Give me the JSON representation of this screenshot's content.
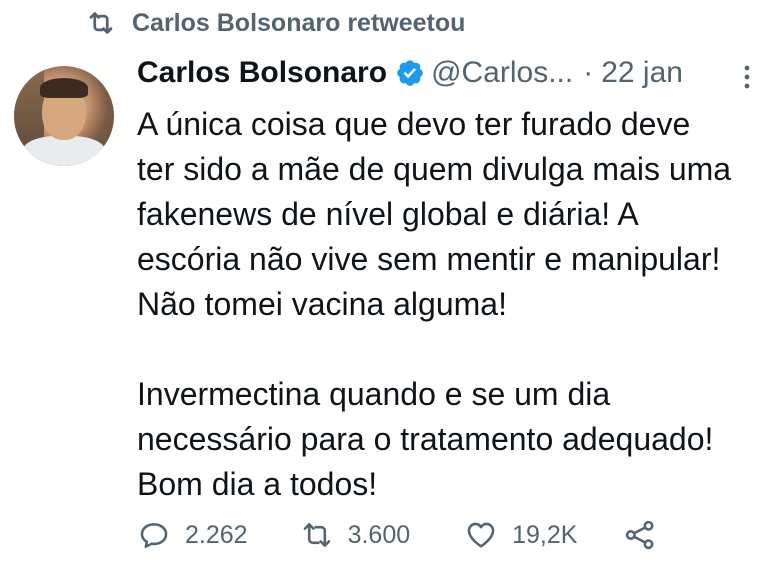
{
  "retweet_banner": {
    "text": "Carlos Bolsonaro retweetou",
    "icon": "retweet-icon"
  },
  "author": {
    "name": "Carlos Bolsonaro",
    "verified": true,
    "handle": "@Carlos...",
    "separator": "·",
    "date": "22 jan"
  },
  "tweet_text": "A única coisa que devo ter furado deve\nter sido a mãe de quem divulga mais uma\nfakenews de nível global e diária! A\nescória não vive sem mentir e manipular!\nNão tomei vacina alguma!\n\nInvermectina quando e se um dia\nnecessário para o tratamento adequado!\nBom dia a todos!",
  "actions": {
    "replies": "2.262",
    "retweets": "3.600",
    "likes": "19,2K"
  },
  "colors": {
    "text": "#0f1419",
    "secondary": "#536471",
    "verified": "#1d9bf0",
    "background": "#ffffff"
  }
}
